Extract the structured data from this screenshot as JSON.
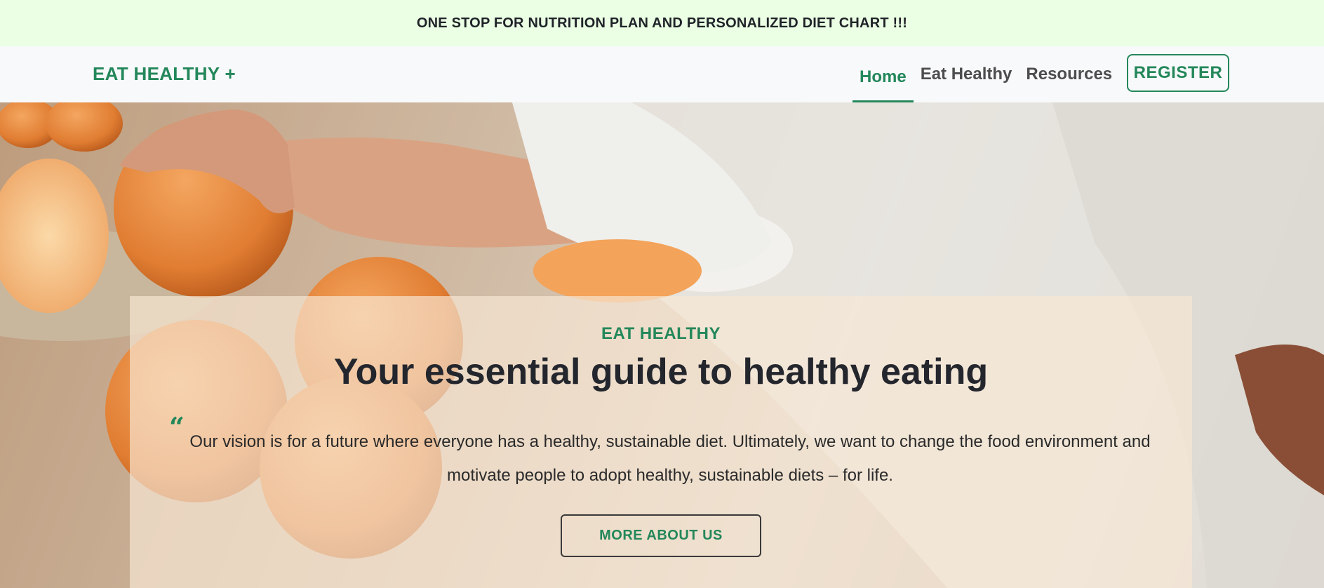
{
  "announcement": "ONE STOP FOR NUTRITION PLAN AND PERSONALIZED DIET CHART !!!",
  "brand": "EAT HEALTHY +",
  "nav": {
    "links": [
      {
        "label": "Home",
        "active": true
      },
      {
        "label": "Eat Healthy",
        "active": false
      },
      {
        "label": "Resources",
        "active": false
      }
    ],
    "register_label": "REGISTER"
  },
  "hero": {
    "image": "hero-photo-oranges-kitchen",
    "eyebrow": "EAT HEALTHY",
    "headline": "Your essential guide to healthy eating",
    "quote_icon": "quote-icon",
    "vision": "Our vision is for a future where everyone has a healthy, sustainable diet. Ultimately, we want to change the food environment and motivate people to adopt healthy, sustainable diets – for life.",
    "button_label": "MORE ABOUT US"
  },
  "colors": {
    "accent": "#23875a",
    "announcement_bg": "#ebffe4",
    "nav_bg": "#f8f9fb",
    "text_dark": "#24262d"
  }
}
